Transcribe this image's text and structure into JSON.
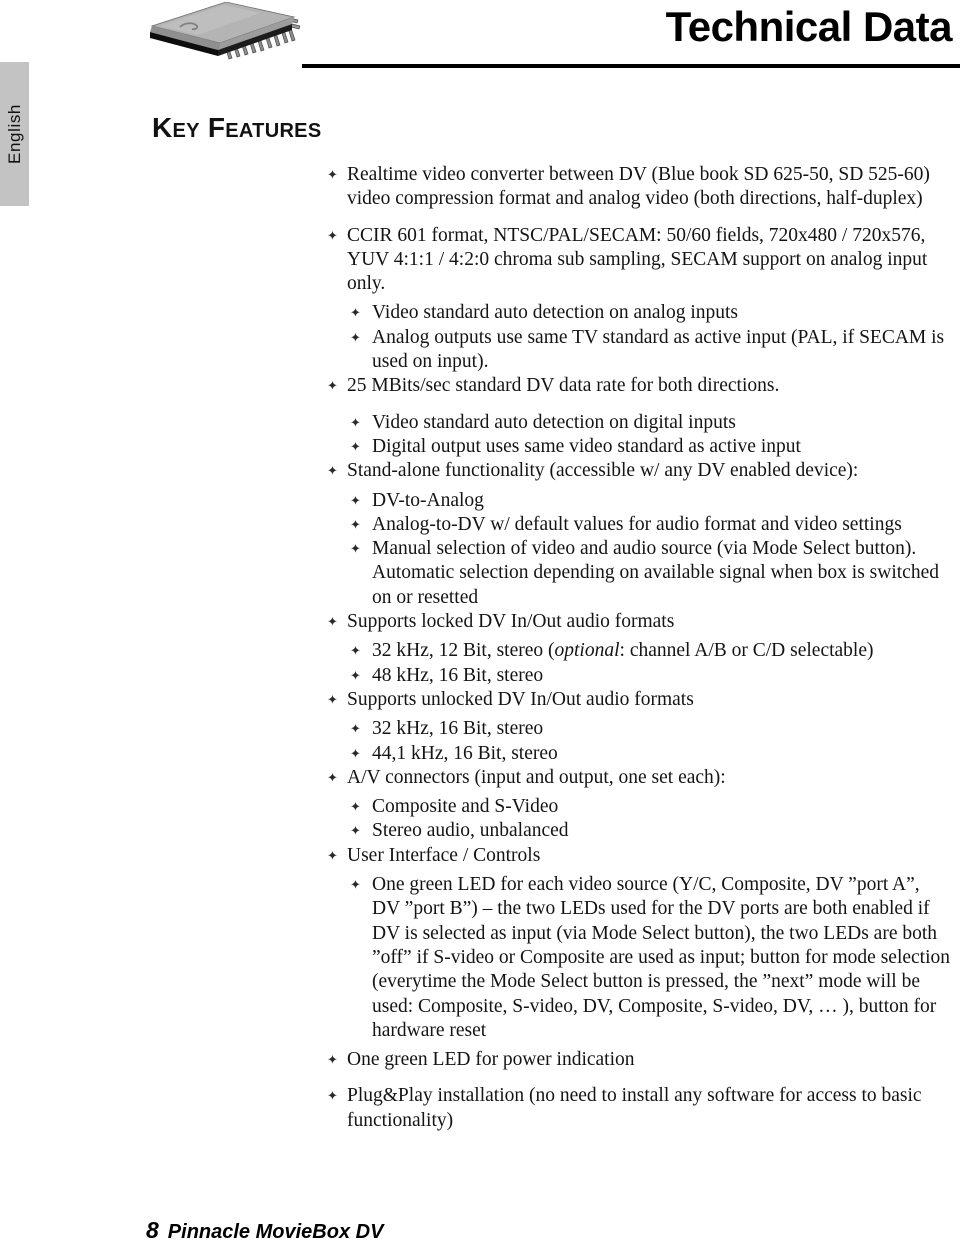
{
  "sidebar": {
    "language_tab": "English"
  },
  "header": {
    "title": "Technical Data",
    "icon": "microchip-icon"
  },
  "section": {
    "heading": "Key Features"
  },
  "features": [
    {
      "level": 1,
      "gap": "none",
      "text": "Realtime video converter between DV (Blue book SD 625-50, SD 525-60) video compression format and analog video (both directions, half-duplex)"
    },
    {
      "level": 1,
      "gap": "large",
      "text": "CCIR 601 format, NTSC/PAL/SECAM: 50/60 fields, 720x480 / 720x576, YUV 4:1:1 / 4:2:0 chroma sub sampling, SECAM support on analog input only."
    },
    {
      "level": 2,
      "gap": "small",
      "text": "Video standard auto detection on analog inputs"
    },
    {
      "level": 2,
      "gap": "none",
      "text": "Analog outputs use same TV standard as active input (PAL, if SECAM is used on input)."
    },
    {
      "level": 1,
      "gap": "none",
      "text": "25 MBits/sec standard DV data rate for both directions."
    },
    {
      "level": 2,
      "gap": "large",
      "text": "Video standard auto detection on digital inputs"
    },
    {
      "level": 2,
      "gap": "none",
      "text": "Digital output uses same video standard as active input"
    },
    {
      "level": 1,
      "gap": "none",
      "text": "Stand-alone functionality (accessible w/ any DV enabled device):"
    },
    {
      "level": 2,
      "gap": "small",
      "text": "DV-to-Analog"
    },
    {
      "level": 2,
      "gap": "none",
      "text": "Analog-to-DV w/ default values for audio format and video settings"
    },
    {
      "level": 2,
      "gap": "none",
      "text": "Manual selection of video and audio source (via Mode Select button). Automatic selection depending on available signal when box is switched on or resetted"
    },
    {
      "level": 1,
      "gap": "none",
      "text": "Supports locked DV In/Out audio formats"
    },
    {
      "level": 2,
      "gap": "small",
      "html": "32 kHz, 12 Bit, stereo (<i>optional</i>: channel A/B or C/D selectable)",
      "text": "32 kHz, 12 Bit, stereo (optional: channel A/B or C/D selectable)"
    },
    {
      "level": 2,
      "gap": "none",
      "text": "48 kHz, 16 Bit, stereo"
    },
    {
      "level": 1,
      "gap": "none",
      "text": "Supports unlocked DV In/Out audio formats"
    },
    {
      "level": 2,
      "gap": "small",
      "text": "32 kHz, 16 Bit, stereo"
    },
    {
      "level": 2,
      "gap": "none",
      "text": "44,1 kHz, 16 Bit, stereo"
    },
    {
      "level": 1,
      "gap": "none",
      "text": "A/V connectors (input and output, one set each):"
    },
    {
      "level": 2,
      "gap": "small",
      "text": "Composite and S-Video"
    },
    {
      "level": 2,
      "gap": "none",
      "text": "Stereo audio, unbalanced"
    },
    {
      "level": 1,
      "gap": "none",
      "text": " User Interface / Controls"
    },
    {
      "level": 2,
      "gap": "small",
      "text": "One green LED for each video source (Y/C, Composite, DV ”port A”, DV ”port B”) – the two LEDs used for the DV ports are both enabled if DV is selected as input (via Mode Select button), the two LEDs are both ”off” if S-video or Composite are used as input; button for mode selection (everytime the Mode Select button is pressed, the ”next” mode will be used: Composite, S-video, DV, Composite, S-video, DV, … ), button for hardware reset"
    },
    {
      "level": 1,
      "gap": "small",
      "text": "One green LED for power indication"
    },
    {
      "level": 1,
      "gap": "large",
      "text": "Plug&Play installation (no need to install any software for access to basic functionality)"
    }
  ],
  "footer": {
    "page_number": "8",
    "document_name": "Pinnacle MovieBox DV"
  },
  "bullet_glyph": "✦"
}
